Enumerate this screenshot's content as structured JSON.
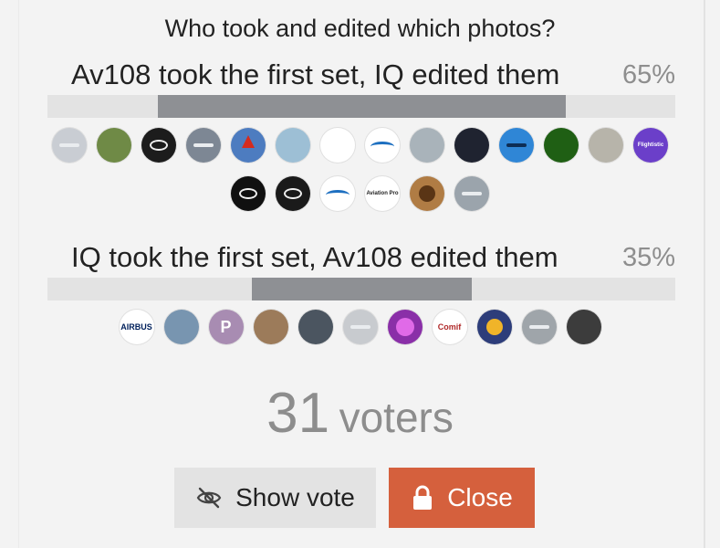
{
  "poll": {
    "question": "Who took and edited which photos?",
    "options": [
      {
        "label": "Av108 took the first set, IQ edited them",
        "percent_text": "65%",
        "percent": 65
      },
      {
        "label": "IQ took the first set, Av108 edited them",
        "percent_text": "35%",
        "percent": 35
      }
    ],
    "avatars_option1_row1": [
      {
        "icon": "avatar-airliner-icon",
        "bg": "#c9cdd3"
      },
      {
        "icon": "avatar-goat-icon",
        "bg": "#6f8a46"
      },
      {
        "icon": "avatar-infinity-logo-icon",
        "bg": "#1c1c1c"
      },
      {
        "icon": "avatar-plane-runway-icon",
        "bg": "#7d8794"
      },
      {
        "icon": "avatar-canada-flag-icon",
        "bg": "#4d7cc0"
      },
      {
        "icon": "avatar-airport-icon",
        "bg": "#9dbfd5"
      },
      {
        "icon": "avatar-bird-sketch-icon",
        "bg": "#ffffff"
      },
      {
        "icon": "avatar-wave-logo-icon",
        "bg": "#ffffff"
      },
      {
        "icon": "avatar-wing-icon",
        "bg": "#a9b3ba"
      },
      {
        "icon": "avatar-dark-feather-icon",
        "bg": "#1f2330"
      },
      {
        "icon": "avatar-jet-blue-icon",
        "bg": "#2f86d6"
      },
      {
        "icon": "avatar-green-dot-icon",
        "bg": "#1f5f14"
      },
      {
        "icon": "avatar-shore-icon",
        "bg": "#b7b4aa"
      },
      {
        "icon": "avatar-flightistic-icon",
        "bg": "#6b3fc9"
      }
    ],
    "avatars_option1_row2": [
      {
        "icon": "avatar-propeller-icon",
        "bg": "#101010"
      },
      {
        "icon": "avatar-cybbro-icon",
        "bg": "#1a1a1a"
      },
      {
        "icon": "avatar-swoosh-logo-icon",
        "bg": "#ffffff"
      },
      {
        "icon": "avatar-aviation-pro-icon",
        "bg": "#ffffff"
      },
      {
        "icon": "avatar-bread-icon",
        "bg": "#b07c44"
      },
      {
        "icon": "avatar-tarmac-icon",
        "bg": "#9ba4ac"
      }
    ],
    "avatars_option2": [
      {
        "icon": "avatar-airbus-logo-icon",
        "bg": "#ffffff"
      },
      {
        "icon": "avatar-window-icon",
        "bg": "#7895b0"
      },
      {
        "icon": "avatar-letter-p-icon",
        "bg": "#a88cb2"
      },
      {
        "icon": "avatar-cat-icon",
        "bg": "#9c7b5a"
      },
      {
        "icon": "avatar-engine-icon",
        "bg": "#4b5560"
      },
      {
        "icon": "avatar-airliner-grey-icon",
        "bg": "#c8cbcf"
      },
      {
        "icon": "avatar-purple-swirl-icon",
        "bg": "#8a2fa8"
      },
      {
        "icon": "avatar-comif-logo-icon",
        "bg": "#ffffff"
      },
      {
        "icon": "avatar-lufthansa-icon",
        "bg": "#2d3d7a"
      },
      {
        "icon": "avatar-apron-icon",
        "bg": "#9fa5aa"
      },
      {
        "icon": "avatar-portrait-icon",
        "bg": "#3c3c3c"
      }
    ],
    "avatar_texts": {
      "airbus": "AIRBUS",
      "letter_p": "P",
      "comif": "Comif",
      "flightistic": "Flightistic",
      "aviation_pro": "Aviation Pro"
    },
    "voters_number": "31",
    "voters_label": "voters",
    "show_vote_label": "Show vote",
    "close_label": "Close",
    "colors": {
      "accent_close": "#d5603d",
      "bar_fill": "#8e9094",
      "bar_track": "#e3e3e3"
    }
  }
}
